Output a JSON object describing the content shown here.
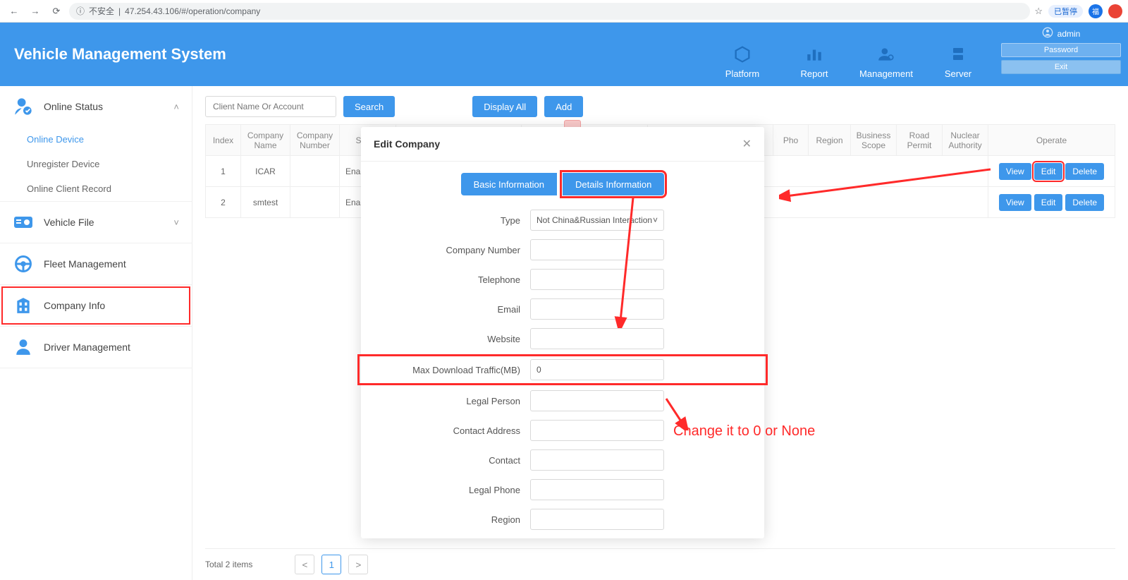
{
  "browser": {
    "url_warn": "不安全",
    "url": "47.254.43.106/#/operation/company",
    "pill": "已暂停",
    "blue_badge": "福"
  },
  "header": {
    "title": "Vehicle Management System",
    "nav": [
      {
        "label": "Platform"
      },
      {
        "label": "Report"
      },
      {
        "label": "Management"
      },
      {
        "label": "Server"
      }
    ],
    "user": "admin",
    "password_btn": "Password",
    "exit_btn": "Exit"
  },
  "sidebar": {
    "online_status": {
      "label": "Online Status",
      "items": [
        "Online Device",
        "Unregister Device",
        "Online Client Record"
      ]
    },
    "vehicle_file": {
      "label": "Vehicle File"
    },
    "fleet": {
      "label": "Fleet Management"
    },
    "company": {
      "label": "Company Info"
    },
    "driver": {
      "label": "Driver Management"
    }
  },
  "toolbar": {
    "search_placeholder": "Client Name Or Account",
    "search": "Search",
    "display_all": "Display All",
    "add": "Add"
  },
  "table": {
    "headers": [
      "Index",
      "Company Name",
      "Company Number",
      "Status",
      "",
      "",
      "",
      "Pho",
      "Region",
      "Business Scope",
      "Road Permit",
      "Nuclear Authority",
      "Operate"
    ],
    "rows": [
      {
        "index": "1",
        "name": "ICAR",
        "status": "Enab"
      },
      {
        "index": "2",
        "name": "smtest",
        "status": "Enab"
      }
    ],
    "view": "View",
    "edit": "Edit",
    "delete": "Delete"
  },
  "pager": {
    "total": "Total 2 items",
    "page": "1"
  },
  "modal": {
    "title": "Edit Company",
    "tab_basic": "Basic Information",
    "tab_details": "Details Information",
    "form": {
      "type_label": "Type",
      "type_value": "Not China&Russian Interaction",
      "company_number": "Company Number",
      "telephone": "Telephone",
      "email": "Email",
      "website": "Website",
      "max_download": "Max Download Traffic(MB)",
      "max_download_value": "0",
      "legal_person": "Legal Person",
      "contact_address": "Contact Address",
      "contact": "Contact",
      "legal_phone": "Legal Phone",
      "region": "Region"
    }
  },
  "annotation": "Change it to 0 or None"
}
